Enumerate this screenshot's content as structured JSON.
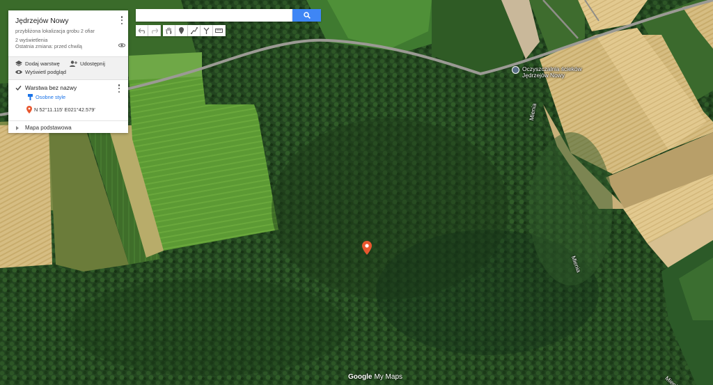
{
  "map_title": "Jędrzejów Nowy",
  "map_description": "przybliżona lokalizacja grobu 2 ofiar",
  "views": "2 wyświetlenia",
  "last_change": "Ostatnia zmiana: przed chwilą",
  "actions": {
    "add_layer": "Dodaj warstwę",
    "share": "Udostępnij",
    "preview": "Wyświetl podgląd"
  },
  "layer": {
    "name": "Warstwa bez nazwy",
    "styles_link": "Osobne style",
    "place": "N 52°11.115' E021°42.579'"
  },
  "basemap_label": "Mapa podstawowa",
  "search": {
    "value": "",
    "placeholder": ""
  },
  "map_labels": {
    "poi_line1": "Oczyszczalnia ścieków",
    "poi_line2": "Jędrzejów Nowy",
    "river_1": "Mienia",
    "river_2": "Mienia",
    "river_3": "Mienia"
  },
  "branding": {
    "google": "Google",
    "my_maps": "My Maps"
  },
  "colors": {
    "marker": "#e8572f",
    "search_button": "#3f86f5",
    "link_blue": "#1a73e8",
    "forest": "#254a20",
    "field_light": "#5fa032",
    "field_wheat": "#d0b878"
  },
  "icons": [
    "undo-icon",
    "redo-icon",
    "hand-icon",
    "marker-icon",
    "line-icon",
    "route-icon",
    "ruler-icon",
    "search-icon",
    "layers-icon",
    "add-person-icon",
    "eye-icon",
    "eye-off-icon",
    "paint-bucket-icon",
    "map-pin-icon"
  ]
}
